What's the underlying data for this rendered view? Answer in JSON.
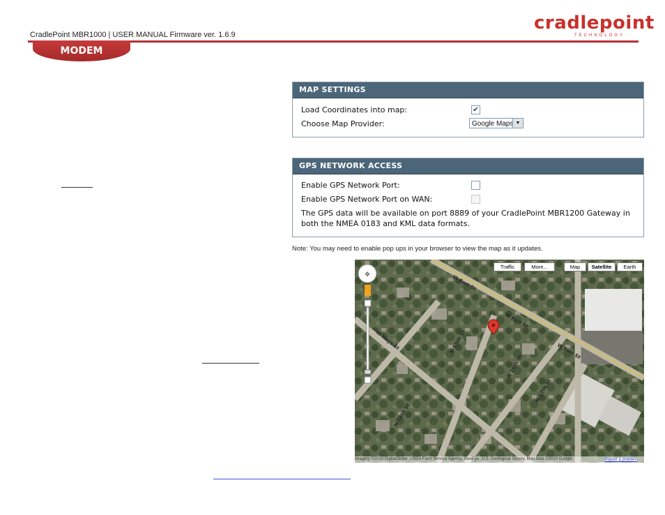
{
  "header": {
    "manual_title": "CradlePoint MBR1000 | USER MANUAL Firmware ver. 1.6.9",
    "logo_word": "cradlepoint",
    "logo_sub": "TECHNOLOGY",
    "section_tab": "MODEM"
  },
  "map_settings": {
    "title": "MAP SETTINGS",
    "load_coords_label": "Load Coordinates into map:",
    "load_coords_checked": true,
    "provider_label": "Choose Map Provider:",
    "provider_value": "Google Maps"
  },
  "gps_network_access": {
    "title": "GPS NETWORK ACCESS",
    "port_label": "Enable GPS Network Port:",
    "port_checked": false,
    "wan_label": "Enable GPS Network Port on WAN:",
    "wan_checked": false,
    "description": "The GPS data will be available on port 8889 of your CradlePoint MBR1200 Gateway in both the NMEA 0183 and KML data formats."
  },
  "note": "Note: You may need to enable pop ups in your browser to view the map as it updates.",
  "map": {
    "buttons": [
      "Traffic",
      "More...",
      "Map",
      "Satellite",
      "Earth"
    ],
    "active_button": "Satellite",
    "street_labels": [
      "W Fort St",
      "W Fort St",
      "W Fort St",
      "N 15th St",
      "N 16th St",
      "N 17th St",
      "N 18th St",
      "W Hays St"
    ],
    "attribution": "Imagery ©2010 DigitalGlobe, USDA Farm Service Agency, GeoEye, U.S. Geological Survey, Map data ©2010 Google",
    "report_link": "Report a problem",
    "colors": {
      "marker": "#d9382c",
      "street_label": "#2b2b2b"
    }
  }
}
